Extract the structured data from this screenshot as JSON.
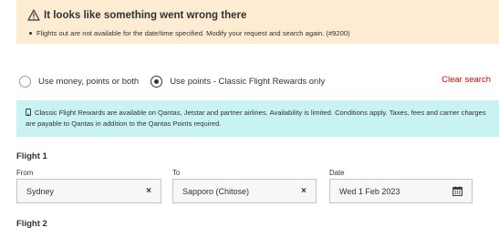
{
  "error": {
    "title": "It looks like something went wrong there",
    "message": "Flights out are not available for the date/time specified. Modify your request and search again. (#9200)"
  },
  "payment_options": {
    "option1": "Use money, points or both",
    "option2": "Use points - Classic Flight Rewards only",
    "selected": "option2",
    "clear_label": "Clear search"
  },
  "info": {
    "text": "Classic Flight Rewards are available on Qantas, Jetstar and partner airlines. Availability is limited. Conditions apply. Taxes, fees and carrier charges are payable to Qantas in addition to the Qantas Points required."
  },
  "flight1": {
    "heading": "Flight 1",
    "from_label": "From",
    "from_value": "Sydney",
    "to_label": "To",
    "to_value": "Sapporo (Chitose)",
    "date_label": "Date",
    "date_value": "Wed 1 Feb 2023",
    "clear_symbol": "×"
  },
  "flight2": {
    "heading": "Flight 2"
  },
  "colors": {
    "error_bg": "#fdecd2",
    "info_bg": "#c9f3f3",
    "accent_red": "#e40000"
  }
}
